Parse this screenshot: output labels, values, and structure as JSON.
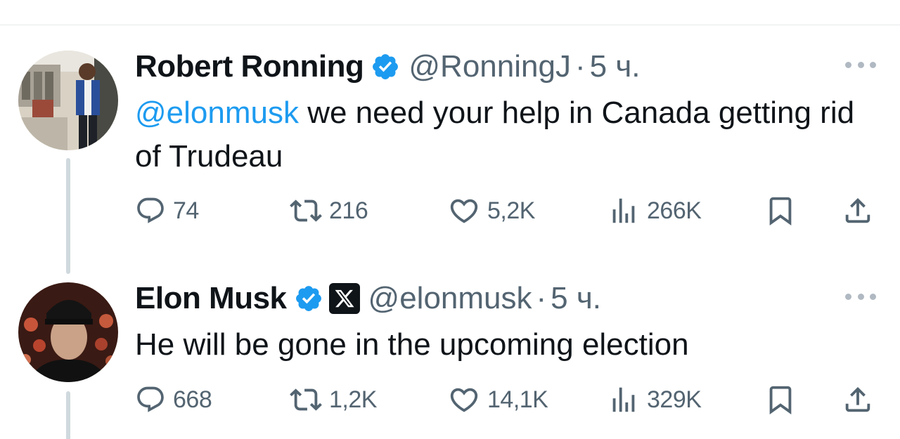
{
  "tweets": [
    {
      "author_name": "Robert Ronning",
      "handle": "@RonningJ",
      "separator": "·",
      "time": "5 ч.",
      "verified": true,
      "affiliate_badge": null,
      "text_mention": "@elonmusk",
      "text_body": " we need your help in Canada getting rid of Trudeau",
      "replies": "74",
      "retweets": "216",
      "likes": "5,2K",
      "views": "266K"
    },
    {
      "author_name": "Elon Musk",
      "handle": "@elonmusk",
      "separator": "·",
      "time": "5 ч.",
      "verified": true,
      "affiliate_badge": "x-logo-icon",
      "text_mention": "",
      "text_body": "He will be gone in the upcoming election",
      "replies": "668",
      "retweets": "1,2K",
      "likes": "14,1K",
      "views": "329K"
    }
  ],
  "colors": {
    "link": "#1d9bf0",
    "secondary_text": "#536471",
    "verified_badge": "#1d9bf0",
    "thread_line": "#cfd9de"
  },
  "icons": [
    "reply-icon",
    "retweet-icon",
    "like-icon",
    "views-icon",
    "bookmark-icon",
    "share-icon",
    "verified-icon",
    "more-icon"
  ]
}
